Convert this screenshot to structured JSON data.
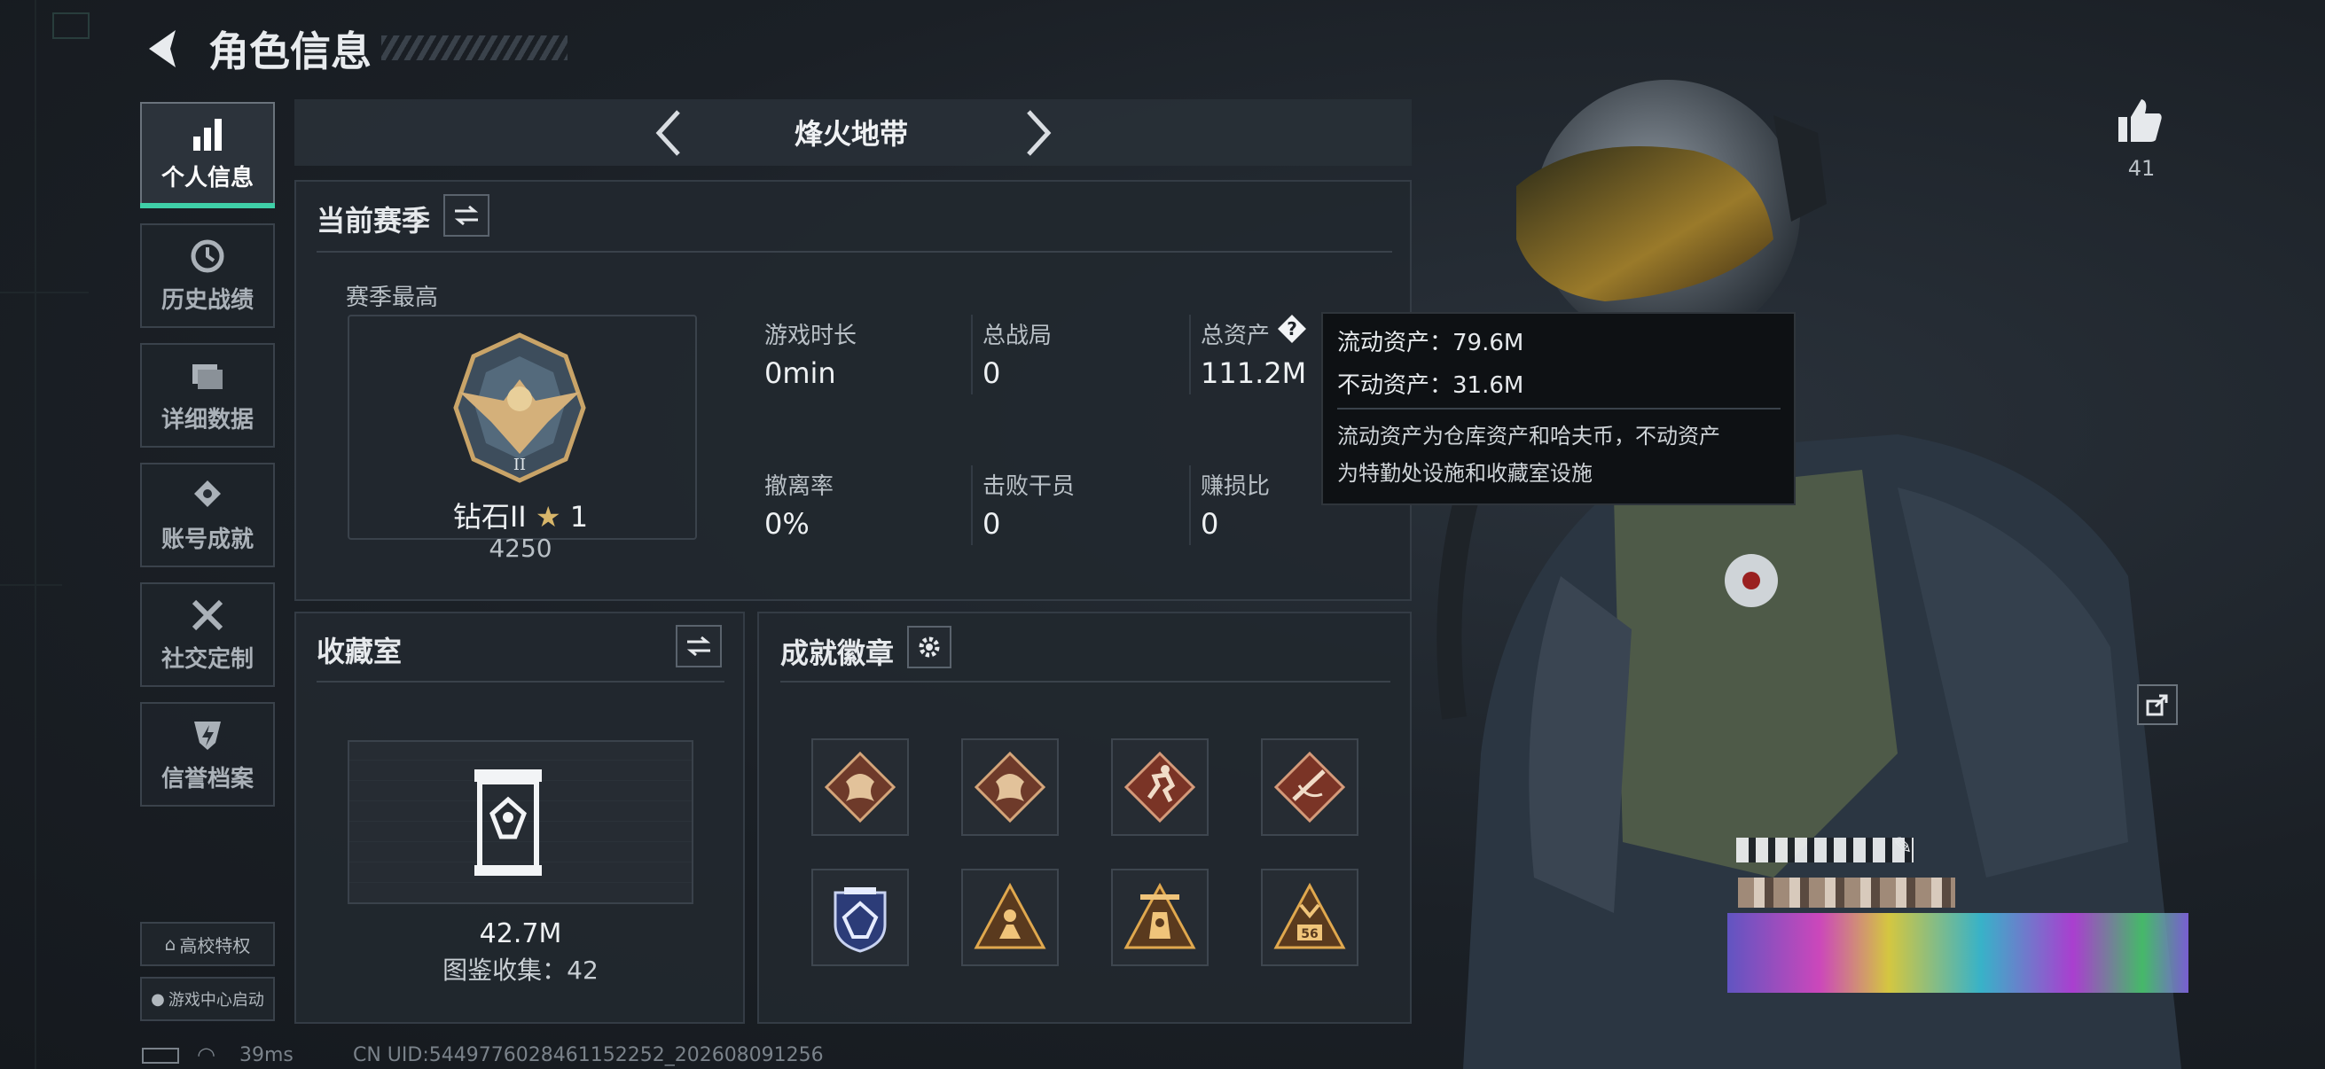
{
  "header": {
    "title": "角色信息"
  },
  "sidebar": {
    "items": [
      {
        "label": "个人信息",
        "icon": "bar-chart-icon",
        "active": true
      },
      {
        "label": "历史战绩",
        "icon": "history-icon"
      },
      {
        "label": "详细数据",
        "icon": "folder-icon"
      },
      {
        "label": "账号成就",
        "icon": "achievement-icon"
      },
      {
        "label": "社交定制",
        "icon": "tools-icon"
      },
      {
        "label": "信誉档案",
        "icon": "shield-bolt-icon"
      }
    ],
    "campus_label": "高校特权",
    "game_center_label": "游戏中心启动"
  },
  "mode_selector": {
    "label": "烽火地带"
  },
  "season": {
    "title": "当前赛季",
    "subtitle": "赛季最高",
    "rank_name": "钻石II",
    "rank_stars": "1",
    "rank_points": "4250",
    "stats": [
      {
        "label": "游戏时长",
        "value": "0min"
      },
      {
        "label": "总战局",
        "value": "0"
      },
      {
        "label": "总资产",
        "value": "111.2M"
      },
      {
        "label": "撤离率",
        "value": "0%"
      },
      {
        "label": "击败干员",
        "value": "0"
      },
      {
        "label": "赚损比",
        "value": "0"
      }
    ]
  },
  "tooltip": {
    "liquid": "流动资产：79.6M",
    "fixed": "不动资产：31.6M",
    "desc_line1": "流动资产为仓库资产和哈夫币，不动资产",
    "desc_line2": "为特勤处设施和收藏室设施"
  },
  "collection": {
    "title": "收藏室",
    "value": "42.7M",
    "catalog": "图鉴收集：42"
  },
  "achievements": {
    "title": "成就徽章",
    "badges": [
      "dragon-badge-icon",
      "dragon-badge-icon",
      "runner-badge-icon",
      "rifle-badge-icon",
      "skull-shield-badge-icon",
      "triangle-soldier-badge-icon",
      "triangle-tower-badge-icon",
      "triangle-number-badge-icon"
    ]
  },
  "right": {
    "likes": "41"
  },
  "status_bar": {
    "ping": "39ms",
    "uid": "CN UID:5449776028461152252_202608091256"
  },
  "colors": {
    "accent": "#3fd0a8",
    "panel": "#22282f",
    "bg": "#1b2026",
    "tooltip": "#0e1114"
  }
}
